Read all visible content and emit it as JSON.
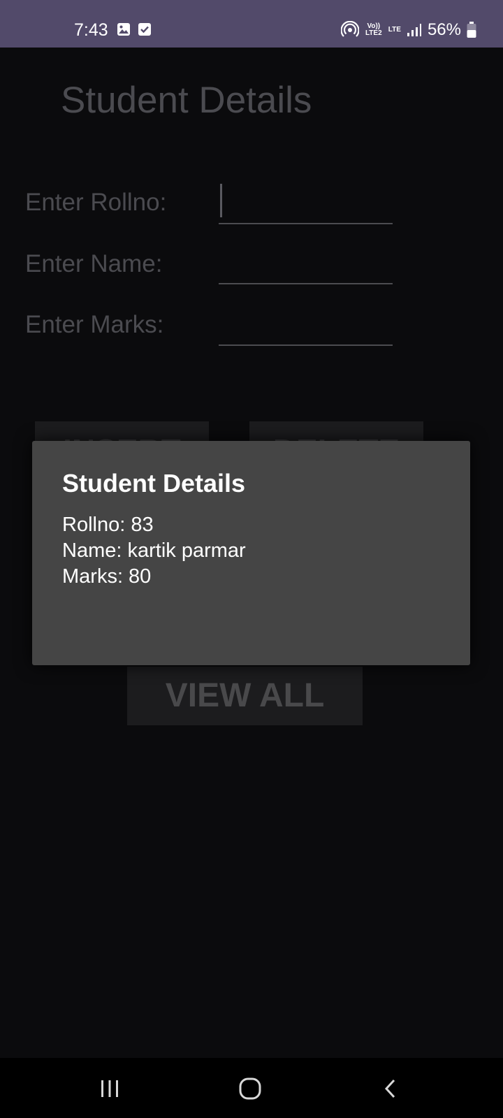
{
  "status_bar": {
    "time": "7:43",
    "left_icons": [
      "image-icon",
      "checkbox-icon"
    ],
    "hotspot_icon": "hotspot-icon",
    "network_label_1": "Vo)) LTE2",
    "network_label_2": "LTE",
    "signal_icon": "signal-icon",
    "battery": "56%",
    "battery_icon": "battery-icon",
    "bg_color": "#524a6a"
  },
  "app": {
    "title": "Student Details",
    "fields": [
      {
        "label": "Enter Rollno:",
        "value": "",
        "focused": true
      },
      {
        "label": "Enter Name:",
        "value": "",
        "focused": false
      },
      {
        "label": "Enter Marks:",
        "value": "",
        "focused": false
      }
    ],
    "buttons": {
      "insert": "INSERT",
      "delete": "DELETE",
      "view_all": "VIEW ALL"
    }
  },
  "dialog": {
    "title": "Student Details",
    "lines": [
      "Rollno: 83",
      "Name: kartik parmar",
      "Marks: 80"
    ],
    "bg_color": "#454545"
  },
  "nav_bar": {
    "recents_icon": "recents-icon",
    "home_icon": "home-icon",
    "back_icon": "back-icon"
  }
}
